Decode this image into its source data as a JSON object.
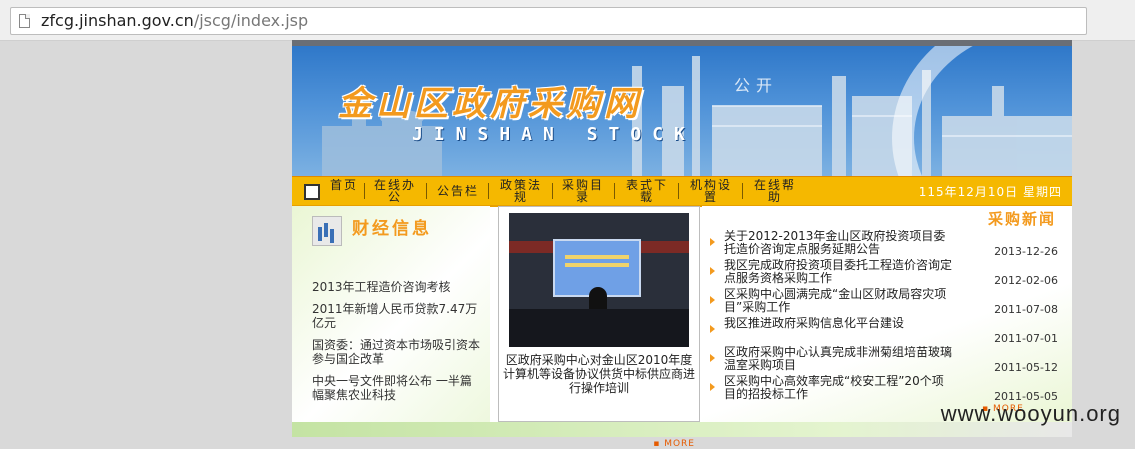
{
  "browser": {
    "url_host": "zfcg.jinshan.gov.cn",
    "url_path": "/jscg/index.jsp",
    "page_icon": "page-icon"
  },
  "header": {
    "site_title": "金山区政府采购网",
    "site_subtitle": "JINSHAN STOCK",
    "open_word": "公开"
  },
  "nav": {
    "items": [
      "首页",
      "在线办公",
      "公告栏",
      "政策法规",
      "采购目录",
      "表式下载",
      "机构设置",
      "在线帮助"
    ],
    "date": "115年12月10日   星期四"
  },
  "finance": {
    "title": "财经信息",
    "items": [
      "2013年工程造价咨询考核",
      "2011年新增人民币贷款7.47万亿元",
      "国资委：通过资本市场吸引资本参与国企改革",
      "中央一号文件即将公布 一半篇幅聚焦农业科技"
    ]
  },
  "feature": {
    "caption": "区政府采购中心对金山区2010年度计算机等设备协议供货中标供应商进行操作培训",
    "more": "MORE"
  },
  "news": {
    "title": "采购新闻",
    "items": [
      {
        "title": "关于2012-2013年金山区政府投资项目委托造价咨询定点服务延期公告",
        "date": "2013-12-26"
      },
      {
        "title": "我区完成政府投资项目委托工程造价咨询定点服务资格采购工作",
        "date": "2012-02-06"
      },
      {
        "title": "区采购中心圆满完成“金山区财政局容灾项目”采购工作",
        "date": "2011-07-08"
      },
      {
        "title": "我区推进政府采购信息化平台建设",
        "date": "2011-07-01"
      },
      {
        "title": "区政府采购中心认真完成非洲菊组培苗玻璃温室采购项目",
        "date": "2011-05-12"
      },
      {
        "title": "区采购中心高效率完成“校安工程”20个项目的招投标工作",
        "date": "2011-05-05"
      }
    ],
    "more": "MORE"
  },
  "watermark": "www.wooyun.org",
  "colors": {
    "accent": "#f39a1e",
    "nav_bg": "#f5b800",
    "banner": "#4f92d8"
  }
}
